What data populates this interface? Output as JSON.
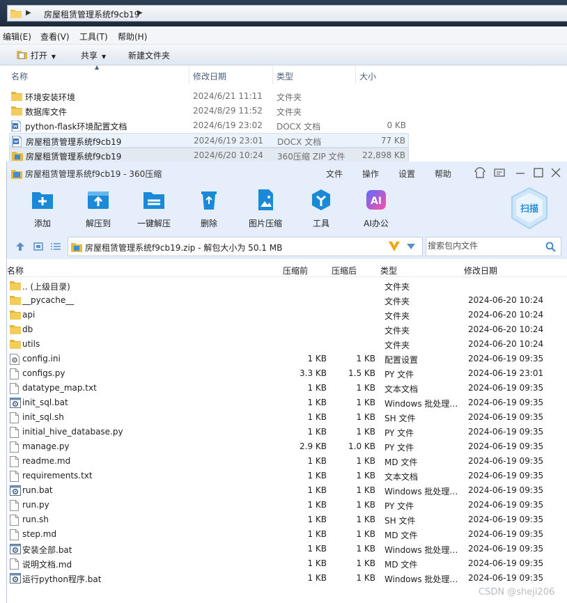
{
  "explorer": {
    "breadcrumb": "房屋租赁管理系统f9cb19",
    "menu": [
      "编辑(E)",
      "查看(V)",
      "工具(T)",
      "帮助(H)"
    ],
    "commands": {
      "open": "打开",
      "share": "共享",
      "new_folder": "新建文件夹"
    },
    "columns": {
      "name": "名称",
      "date": "修改日期",
      "type": "类型",
      "size": "大小"
    },
    "files": [
      {
        "name": "环境安装环境",
        "date": "2024/6/21 11:11",
        "type": "文件夹",
        "size": "",
        "icon": "folder-icon"
      },
      {
        "name": "数据库文件",
        "date": "2024/8/29 11:52",
        "type": "文件夹",
        "size": "",
        "icon": "folder-icon"
      },
      {
        "name": "python-flask环境配置文档",
        "date": "2024/6/19 23:02",
        "type": "DOCX 文档",
        "size": "0 KB",
        "icon": "word-doc-icon"
      },
      {
        "name": "房屋租赁管理系统f9cb19",
        "date": "2024/6/19 23:01",
        "type": "DOCX 文档",
        "size": "77 KB",
        "icon": "word-doc-icon"
      },
      {
        "name": "房屋租赁管理系统f9cb19",
        "date": "2024/6/20 10:24",
        "type": "360压缩 ZIP 文件",
        "size": "22,898 KB",
        "icon": "zip-archive-icon"
      }
    ]
  },
  "zip": {
    "title": "房屋租赁管理系统f9cb19 - 360压缩",
    "menu": [
      "文件",
      "操作",
      "设置",
      "帮助"
    ],
    "toolbar": {
      "add": "添加",
      "extract_to": "解压到",
      "one_click_extract": "一键解压",
      "delete": "删除",
      "image_compress": "图片压缩",
      "tools": "工具",
      "ai_office": "AI办公",
      "scan": "扫描",
      "ai_badge": "AI"
    },
    "path": "房屋租赁管理系统f9cb19.zip - 解包大小为 50.1 MB",
    "search_placeholder": "搜索包内文件",
    "columns": {
      "name": "名称",
      "before": "压缩前",
      "after": "压缩后",
      "type": "类型",
      "date": "修改日期"
    },
    "files": [
      {
        "name": ".. (上级目录)",
        "before": "",
        "after": "",
        "type": "文件夹",
        "date": "",
        "icon": "folder-icon"
      },
      {
        "name": "__pycache__",
        "before": "",
        "after": "",
        "type": "文件夹",
        "date": "2024-06-20 10:24",
        "icon": "folder-icon"
      },
      {
        "name": "api",
        "before": "",
        "after": "",
        "type": "文件夹",
        "date": "2024-06-20 10:24",
        "icon": "folder-icon"
      },
      {
        "name": "db",
        "before": "",
        "after": "",
        "type": "文件夹",
        "date": "2024-06-20 10:24",
        "icon": "folder-icon"
      },
      {
        "name": "utils",
        "before": "",
        "after": "",
        "type": "文件夹",
        "date": "2024-06-20 10:24",
        "icon": "folder-icon"
      },
      {
        "name": "config.ini",
        "before": "1 KB",
        "after": "1 KB",
        "type": "配置设置",
        "date": "2024-06-19 09:35",
        "icon": "settings-file-icon"
      },
      {
        "name": "configs.py",
        "before": "3.3 KB",
        "after": "1.5 KB",
        "type": "PY 文件",
        "date": "2024-06-19 23:01",
        "icon": "file-icon"
      },
      {
        "name": "datatype_map.txt",
        "before": "1 KB",
        "after": "1 KB",
        "type": "文本文档",
        "date": "2024-06-19 09:35",
        "icon": "file-icon"
      },
      {
        "name": "init_sql.bat",
        "before": "1 KB",
        "after": "1 KB",
        "type": "Windows 批处理…",
        "date": "2024-06-19 09:35",
        "icon": "batch-file-icon"
      },
      {
        "name": "init_sql.sh",
        "before": "1 KB",
        "after": "1 KB",
        "type": "SH 文件",
        "date": "2024-06-19 09:35",
        "icon": "file-icon"
      },
      {
        "name": "initial_hive_database.py",
        "before": "1 KB",
        "after": "1 KB",
        "type": "PY 文件",
        "date": "2024-06-19 09:35",
        "icon": "file-icon"
      },
      {
        "name": "manage.py",
        "before": "2.9 KB",
        "after": "1.0 KB",
        "type": "PY 文件",
        "date": "2024-06-19 09:35",
        "icon": "file-icon"
      },
      {
        "name": "readme.md",
        "before": "1 KB",
        "after": "1 KB",
        "type": "MD 文件",
        "date": "2024-06-19 09:35",
        "icon": "file-icon"
      },
      {
        "name": "requirements.txt",
        "before": "1 KB",
        "after": "1 KB",
        "type": "文本文档",
        "date": "2024-06-19 09:35",
        "icon": "file-icon"
      },
      {
        "name": "run.bat",
        "before": "1 KB",
        "after": "1 KB",
        "type": "Windows 批处理…",
        "date": "2024-06-19 09:35",
        "icon": "batch-file-icon"
      },
      {
        "name": "run.py",
        "before": "1 KB",
        "after": "1 KB",
        "type": "PY 文件",
        "date": "2024-06-19 09:35",
        "icon": "file-icon"
      },
      {
        "name": "run.sh",
        "before": "1 KB",
        "after": "1 KB",
        "type": "SH 文件",
        "date": "2024-06-19 09:35",
        "icon": "file-icon"
      },
      {
        "name": "step.md",
        "before": "1 KB",
        "after": "1 KB",
        "type": "MD 文件",
        "date": "2024-06-19 09:35",
        "icon": "file-icon"
      },
      {
        "name": "安装全部.bat",
        "before": "1 KB",
        "after": "1 KB",
        "type": "Windows 批处理…",
        "date": "2024-06-19 09:35",
        "icon": "batch-file-icon"
      },
      {
        "name": "说明文档.md",
        "before": "1 KB",
        "after": "1 KB",
        "type": "MD 文件",
        "date": "2024-06-19 09:35",
        "icon": "file-icon"
      },
      {
        "name": "运行python程序.bat",
        "before": "1 KB",
        "after": "1 KB",
        "type": "Windows 批处理…",
        "date": "2024-06-19 09:35",
        "icon": "batch-file-icon"
      }
    ]
  },
  "watermark": "CSDN @sheji206",
  "colors": {
    "zip_chrome": "#e5eefa",
    "accent_blue": "#1a8ad8",
    "folder_yellow": "#f0c24a",
    "selection": "#eaf2fb"
  }
}
